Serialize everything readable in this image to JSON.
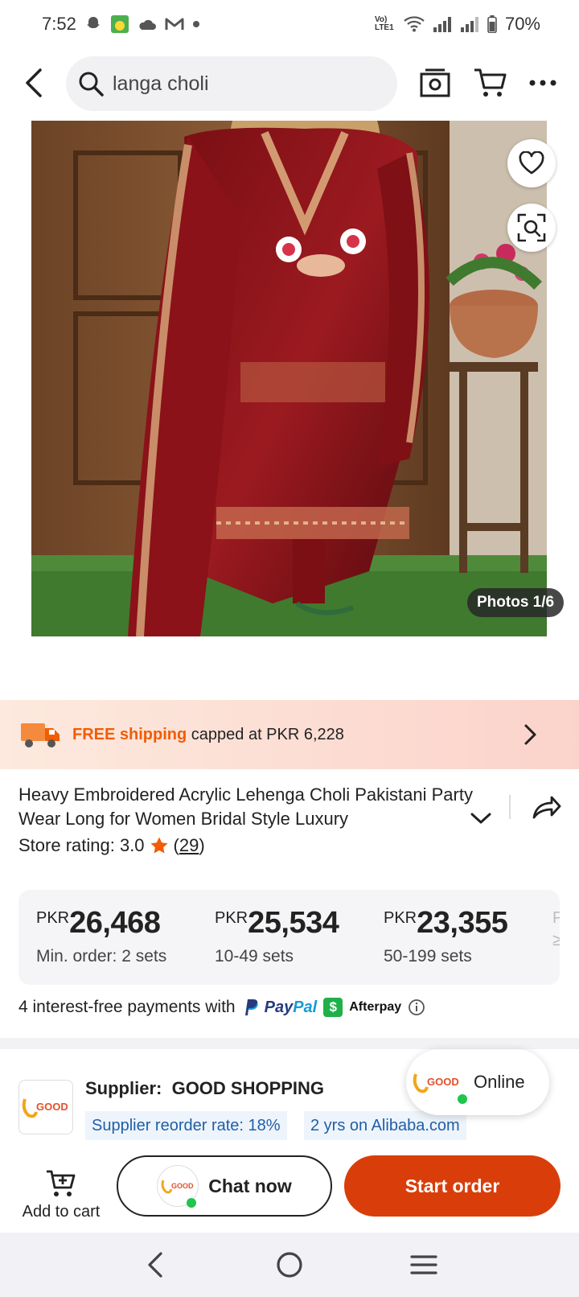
{
  "status_bar": {
    "time": "7:52",
    "network_label": "Vo) LTE1",
    "battery": "70%"
  },
  "header": {
    "search_query": "langa choli",
    "icons": [
      "back-arrow-icon",
      "search-icon",
      "camera-icon",
      "cart-icon",
      "more-icon"
    ]
  },
  "gallery": {
    "photo_counter": "Photos 1/6"
  },
  "shipping": {
    "highlight": "FREE shipping",
    "rest": " capped at PKR 6,228"
  },
  "product": {
    "title": "Heavy Embroidered Acrylic Lehenga Choli Pakistani Party Wear Long for Women Bridal Style Luxury",
    "rating_label": "Store rating: 3.0",
    "rating_open": "(",
    "rating_count": "29",
    "rating_close": ")"
  },
  "price_tiers": [
    {
      "currency": "PKR",
      "amount": "26,468",
      "qty": "Min. order: 2 sets"
    },
    {
      "currency": "PKR",
      "amount": "25,534",
      "qty": "10-49 sets"
    },
    {
      "currency": "PKR",
      "amount": "23,355",
      "qty": "50-199 sets"
    },
    {
      "currency": "P",
      "amount": "",
      "qty": "≥"
    }
  ],
  "payments": {
    "text": "4 interest-free payments with",
    "paypal_a": "Pay",
    "paypal_b": "Pal",
    "afterpay_badge": "$",
    "afterpay": "Afterpay"
  },
  "supplier": {
    "label": "Supplier:",
    "name": "GOOD SHOPPING",
    "logo_text": "GOOD",
    "tags": [
      "Supplier reorder rate: 18%",
      "2 yrs on Alibaba.com"
    ],
    "online": "Online"
  },
  "actions": {
    "add_to_cart": "Add to cart",
    "chat": "Chat now",
    "start_order": "Start order"
  },
  "colors": {
    "accent": "#d93e0a",
    "free_shipping": "#f25c05",
    "tag_text": "#1f5fa8",
    "online_dot": "#1ec54f"
  }
}
